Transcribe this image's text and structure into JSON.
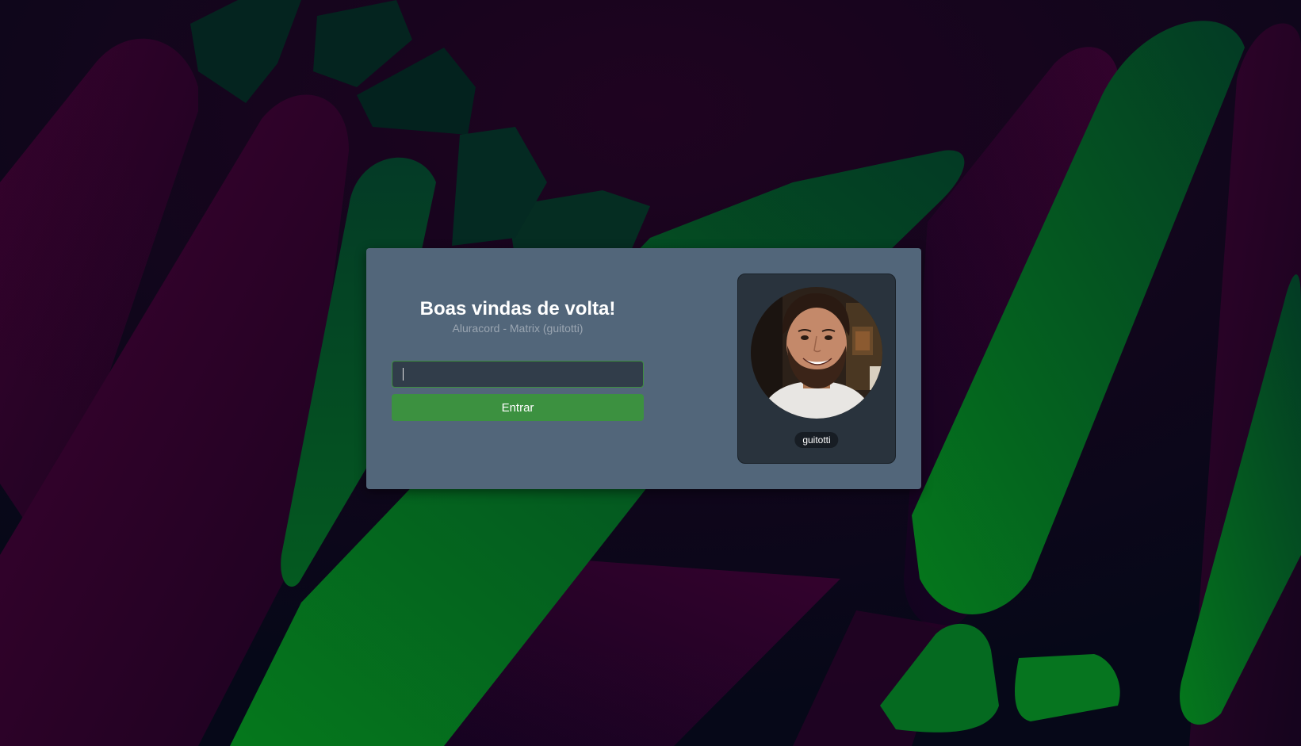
{
  "login": {
    "title": "Boas vindas de volta!",
    "subtitle": "Aluracord - Matrix (guitotti)",
    "username_value": "",
    "submit_label": "Entrar"
  },
  "profile": {
    "username": "guitotti",
    "avatar_icon": "user-photo"
  },
  "colors": {
    "card_background": "#52667a",
    "profile_background": "#29333d",
    "submit_button": "#3c9140",
    "input_background": "#313d4a",
    "input_border": "#3d8f3f"
  }
}
